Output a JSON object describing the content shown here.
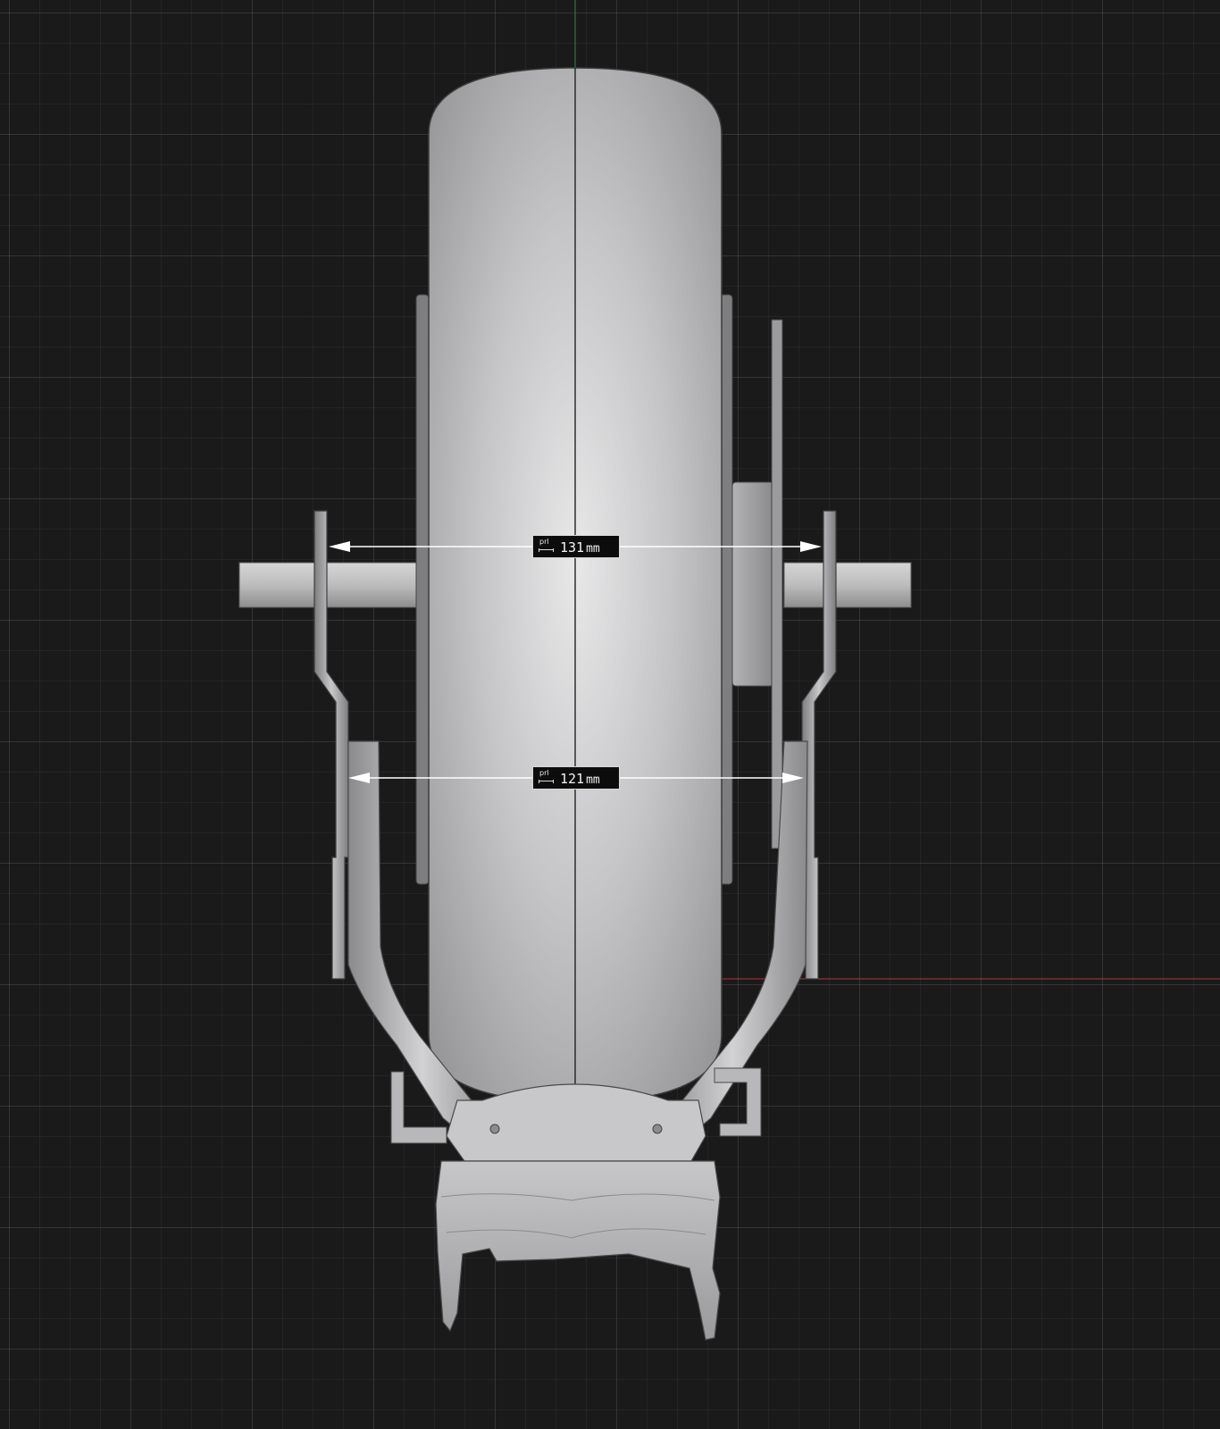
{
  "viewport": {
    "background": "#1a1a1b",
    "grid": true,
    "axis_y_color": "#2e8b3e",
    "axis_x_color": "#a83a3a"
  },
  "measurements": [
    {
      "icon": "prl",
      "value": "131",
      "unit": "mm"
    },
    {
      "icon": "prl",
      "value": "121",
      "unit": "mm"
    }
  ],
  "model": {
    "surface_color": "#bdbdbd"
  }
}
